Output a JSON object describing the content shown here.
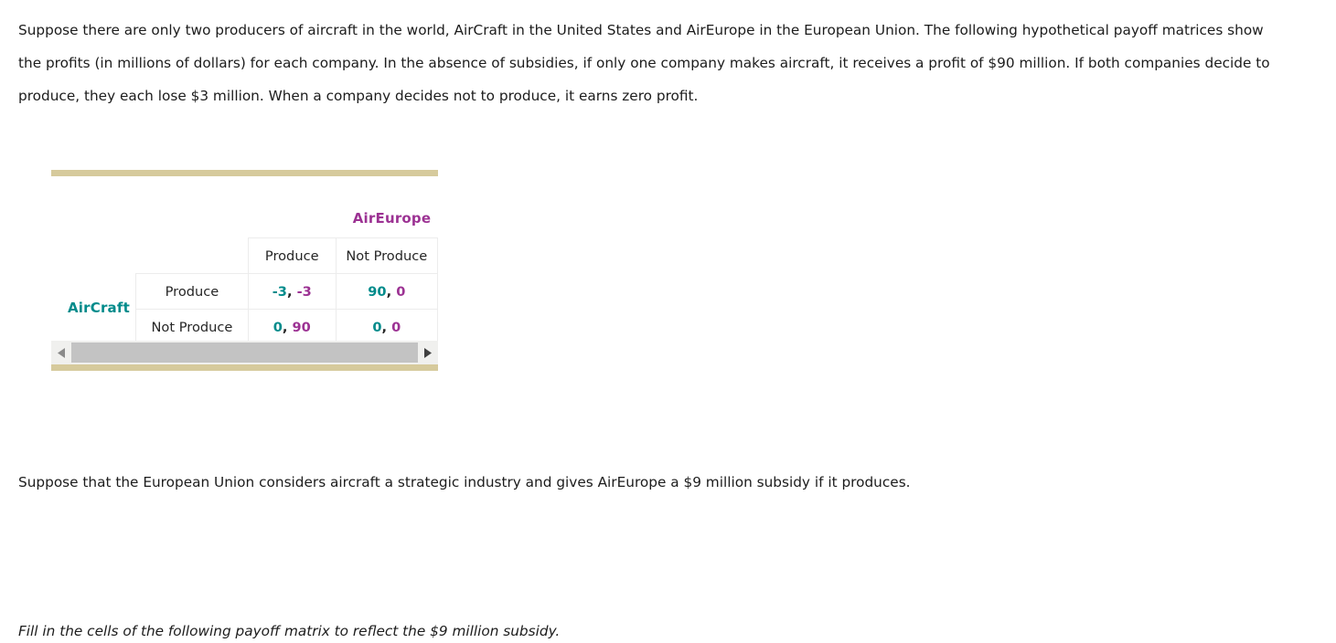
{
  "intro": {
    "text": "Suppose there are only two producers of aircraft in the world, AirCraft in the United States and AirEurope in the European Union. The following hypothetical payoff matrices show the profits (in millions of dollars) for each company. In the absence of subsidies, if only one company makes aircraft, it receives a profit of $90 million. If both companies decide to produce, they each lose $3 million. When a company decides not to produce, it earns zero profit."
  },
  "matrix": {
    "column_player": "AirEurope",
    "row_player": "AirCraft",
    "column_headers": [
      "Produce",
      "Not Produce"
    ],
    "row_headers": [
      "Produce",
      "Not Produce"
    ],
    "cells": [
      [
        {
          "a": "-3",
          "b": "-3"
        },
        {
          "a": "90",
          "b": "0"
        }
      ],
      [
        {
          "a": "0",
          "b": "90"
        },
        {
          "a": "0",
          "b": "0"
        }
      ]
    ],
    "separator": ", ",
    "colors": {
      "row_player": "#008b8b",
      "column_player": "#9c3293",
      "rule": "#d6ca9c",
      "cell_border": "#ececec",
      "scrollbar_thumb": "#c3c3c3",
      "scrollbar_track": "#f0f0ee"
    }
  },
  "scrollbar": {
    "left_arrow": "triangle-left-icon",
    "right_arrow": "triangle-right-icon"
  },
  "paragraphs": {
    "subsidy": "Suppose that the European Union considers aircraft a strategic industry and gives AirEurope a $9 million subsidy if it produces.",
    "instruction": "Fill in the cells of the following payoff matrix to reflect the $9 million subsidy."
  }
}
